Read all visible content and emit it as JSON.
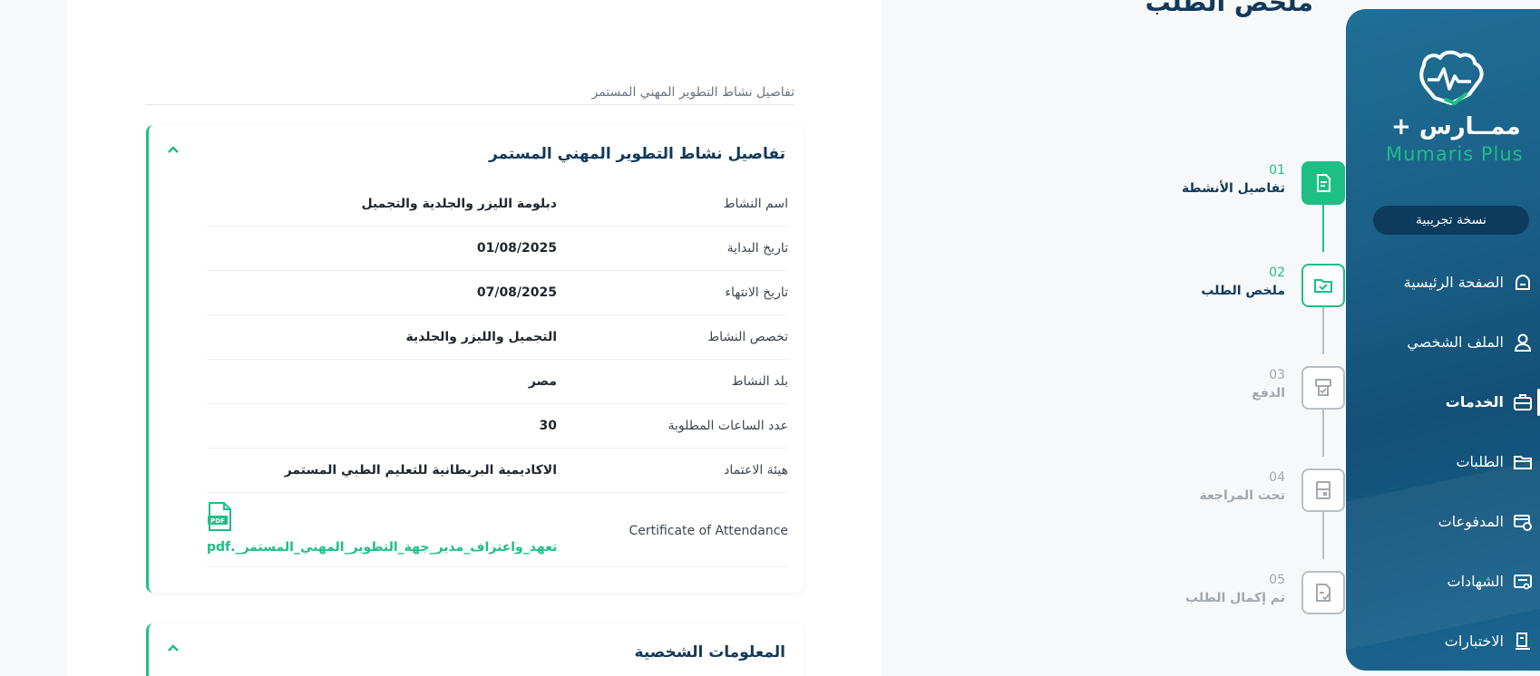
{
  "page": {
    "title": "ملخص الطلب",
    "section_tab": "تفاصيل نشاط التطوير المهني المستمر"
  },
  "activity_card": {
    "title": "تفاصيل نشاط التطوير المهني المستمر",
    "rows": [
      {
        "label": "اسم النشاط",
        "value": "دبلومة الليزر والجلدية والتجميل"
      },
      {
        "label": "تاريخ البداية",
        "value": "01/08/2025"
      },
      {
        "label": "تاريخ الانتهاء",
        "value": "07/08/2025"
      },
      {
        "label": "تخصص النشاط",
        "value": "التجميل والليزر والجلدية"
      },
      {
        "label": "بلد النشاط",
        "value": "مصر"
      },
      {
        "label": "عدد الساعات المطلوبة",
        "value": "30"
      },
      {
        "label": "هيئة الاعتماد",
        "value": "الاكاديمية البريطانية للتعليم الطبي المستمر"
      }
    ],
    "certificate": {
      "label": "Certificate of Attendance",
      "icon": "pdf-file-icon",
      "pdf_icon_text": "PDF",
      "file_name": "تعهد_واعتراف_مدير_جهة_التطوير_المهني_المستمر_.pdf"
    }
  },
  "personal_card": {
    "title": "المعلومات الشخصية"
  },
  "stepper": {
    "steps": [
      {
        "number": "01",
        "label": "تفاصيل الأنشطة",
        "state": "done",
        "icon": "document-icon"
      },
      {
        "number": "02",
        "label": "ملخص الطلب",
        "state": "current",
        "icon": "folder-check-icon"
      },
      {
        "number": "03",
        "label": "الدفع",
        "state": "inactive",
        "icon": "payment-terminal-icon"
      },
      {
        "number": "04",
        "label": "تحت المراجعة",
        "state": "inactive",
        "icon": "review-document-icon"
      },
      {
        "number": "05",
        "label": "تم إكمال الطلب",
        "state": "inactive",
        "icon": "completed-document-icon"
      }
    ]
  },
  "sidebar": {
    "brand_ar": "ممــارس +",
    "brand_en": "Mumaris Plus",
    "trial_badge": "نسخة تجريبية",
    "items": [
      {
        "label": "الصفحة الرئيسية",
        "icon": "home-icon"
      },
      {
        "label": "الملف الشخصي",
        "icon": "user-icon"
      },
      {
        "label": "الخدمات",
        "icon": "briefcase-icon",
        "active": true
      },
      {
        "label": "الطلبات",
        "icon": "folder-icon"
      },
      {
        "label": "المدفوعات",
        "icon": "payments-icon"
      },
      {
        "label": "الشهادات",
        "icon": "certificate-icon"
      },
      {
        "label": "الاختبارات",
        "icon": "exam-icon"
      }
    ]
  },
  "colors": {
    "accent": "#1dbf84",
    "primary_text": "#12395a",
    "sidebar_bg": "#1a5f86"
  }
}
